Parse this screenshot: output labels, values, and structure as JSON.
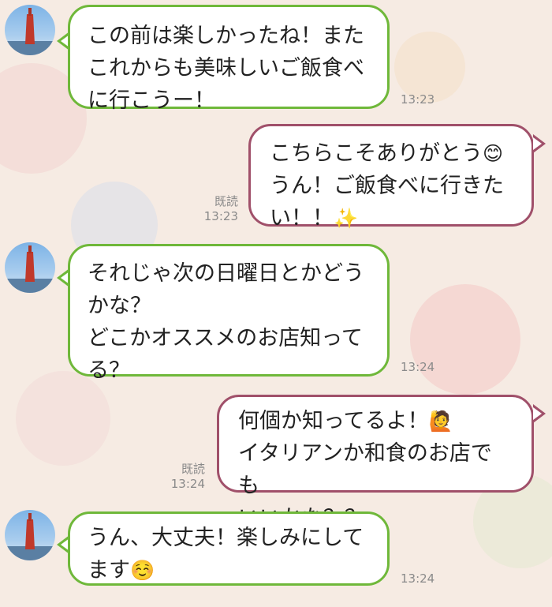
{
  "messages": [
    {
      "side": "in",
      "text": "この前は楽しかったね！また\nこれからも美味しいご飯食べ\nに行こうー！",
      "time": "13:23"
    },
    {
      "side": "out",
      "text": "こちらこそありがとう",
      "emoji": "😊",
      "text2": "うん！ご飯食べに行きた\nい！！",
      "emoji2": "✨",
      "read": "既読",
      "time": "13:23"
    },
    {
      "side": "in",
      "text": "それじゃ次の日曜日とかどう\nかな？\nどこかオススメのお店知って\nる？",
      "time": "13:24"
    },
    {
      "side": "out",
      "text": "何個か知ってるよ！",
      "emoji": "🙋",
      "text2": "イタリアンか和食のお店でも\nいいかな？？",
      "read": "既読",
      "time": "13:24"
    },
    {
      "side": "in",
      "text": "うん、大丈夫！楽しみにして\nます",
      "emoji": "☺️",
      "time": "13:24"
    }
  ],
  "colors": {
    "incoming_border": "#6fb83a",
    "outgoing_border": "#a0506a",
    "background": "#f6ebe3"
  }
}
